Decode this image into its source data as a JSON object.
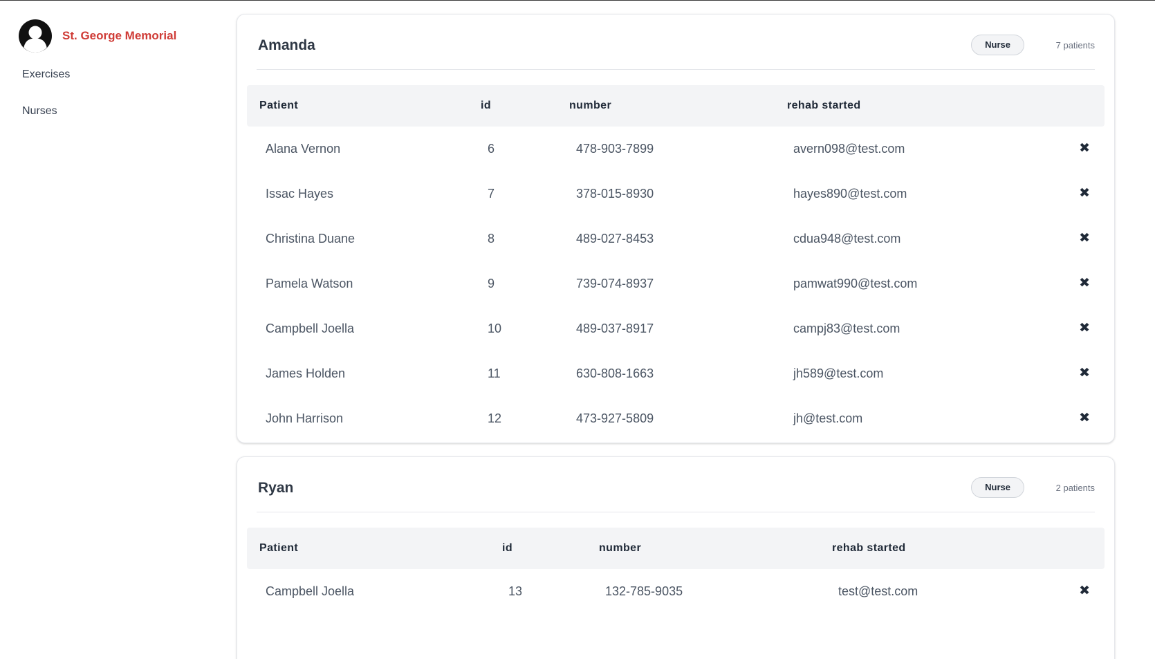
{
  "sidebar": {
    "brand": "St. George Memorial",
    "nav": [
      {
        "label": "Exercises"
      },
      {
        "label": "Nurses"
      }
    ]
  },
  "theme": {
    "brand_color": "#cf3b36",
    "header_bg": "#f3f4f6"
  },
  "icons": {
    "avatar": "user-avatar-icon",
    "remove": "close-x-icon"
  },
  "cards": [
    {
      "name": "Amanda",
      "role": "Nurse",
      "count": "7 patients",
      "columns": [
        "Patient",
        "id",
        "number",
        "rehab started"
      ],
      "rows": [
        {
          "patient": "Alana Vernon",
          "id": "6",
          "number": "478-903-7899",
          "rehab": "avern098@test.com"
        },
        {
          "patient": "Issac Hayes",
          "id": "7",
          "number": "378-015-8930",
          "rehab": "hayes890@test.com"
        },
        {
          "patient": "Christina Duane",
          "id": "8",
          "number": "489-027-8453",
          "rehab": "cdua948@test.com"
        },
        {
          "patient": "Pamela Watson",
          "id": "9",
          "number": "739-074-8937",
          "rehab": "pamwat990@test.com"
        },
        {
          "patient": "Campbell Joella",
          "id": "10",
          "number": "489-037-8917",
          "rehab": "campj83@test.com"
        },
        {
          "patient": "James Holden",
          "id": "11",
          "number": "630-808-1663",
          "rehab": "jh589@test.com"
        },
        {
          "patient": "John Harrison",
          "id": "12",
          "number": "473-927-5809",
          "rehab": "jh@test.com"
        }
      ]
    },
    {
      "name": "Ryan",
      "role": "Nurse",
      "count": "2 patients",
      "columns": [
        "Patient",
        "id",
        "number",
        "rehab started"
      ],
      "rows": [
        {
          "patient": "Campbell Joella",
          "id": "13",
          "number": "132-785-9035",
          "rehab": "test@test.com"
        }
      ]
    }
  ]
}
